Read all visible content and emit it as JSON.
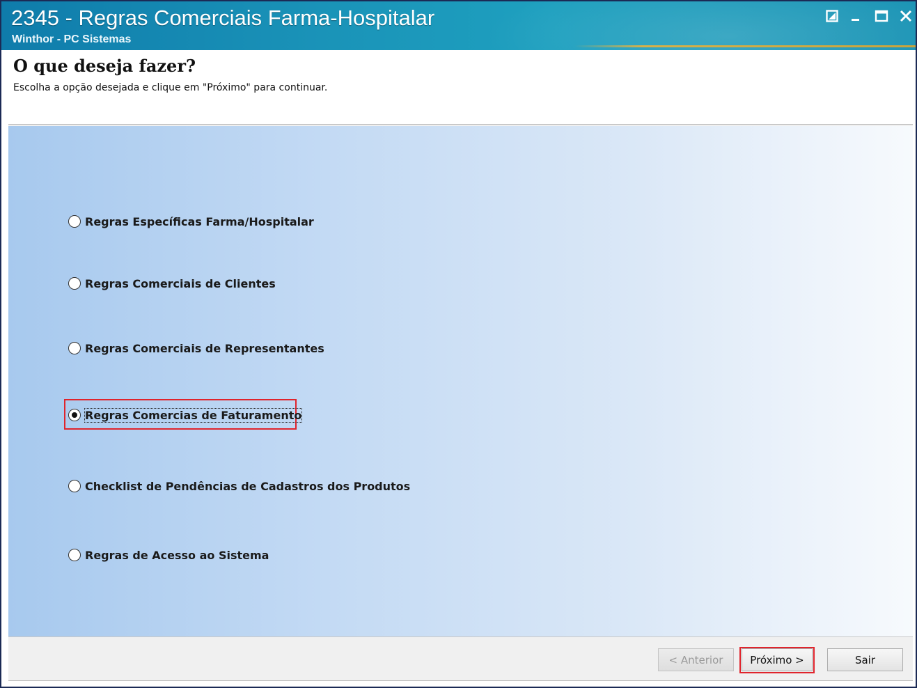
{
  "window": {
    "title": "2345 - Regras Comerciais Farma-Hospitalar",
    "subtitle": "Winthor - PC Sistemas"
  },
  "header": {
    "heading": "O que deseja fazer?",
    "description": "Escolha a opção desejada e clique em \"Próximo\" para continuar."
  },
  "options": [
    {
      "label": "Regras Específicas Farma/Hospitalar",
      "selected": false
    },
    {
      "label": "Regras Comerciais de Clientes",
      "selected": false
    },
    {
      "label": "Regras Comerciais de Representantes",
      "selected": false
    },
    {
      "label": "Regras Comercias de Faturamento",
      "selected": true
    },
    {
      "label": "Checklist de Pendências de Cadastros dos Produtos",
      "selected": false
    },
    {
      "label": "Regras de Acesso ao Sistema",
      "selected": false
    }
  ],
  "buttons": {
    "previous": {
      "label": "< Anterior",
      "enabled": false
    },
    "next": {
      "label": "Próximo >",
      "enabled": true
    },
    "exit": {
      "label": "Sair",
      "enabled": true
    }
  },
  "icons": {
    "restore": "restore-icon",
    "minimize": "minimize-icon",
    "maximize": "maximize-icon",
    "close": "close-icon"
  },
  "colors": {
    "titlebar": "#1a93b8",
    "highlight": "#e0242c",
    "panel_left": "#a7c9ee",
    "panel_right": "#f7fafd"
  }
}
